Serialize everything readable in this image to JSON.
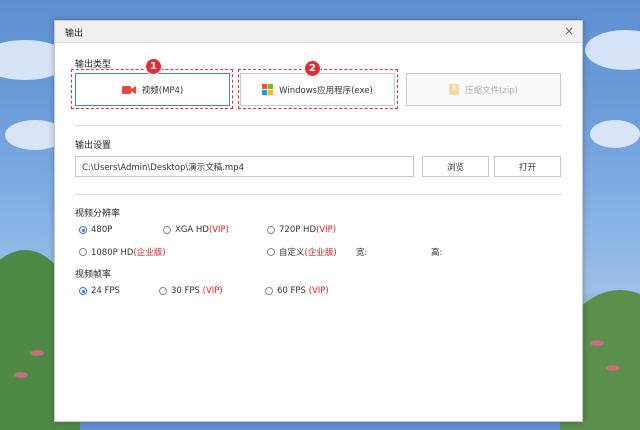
{
  "dialog": {
    "title": "输出",
    "close_glyph": "×"
  },
  "output_type": {
    "heading": "输出类型",
    "options": [
      {
        "label": "视频(MP4)",
        "icon": "video-camera-icon",
        "selected": true,
        "badge": "1"
      },
      {
        "label": "Windows应用程序(exe)",
        "icon": "windows-icon",
        "selected": false,
        "badge": "2"
      },
      {
        "label": "压缩文件(zip)",
        "icon": "zip-archive-icon",
        "selected": false,
        "disabled": true
      }
    ]
  },
  "output_settings": {
    "heading": "输出设置",
    "path_value": "C:\\Users\\Admin\\Desktop\\演示文稿.mp4",
    "browse_label": "浏览",
    "open_label": "打开"
  },
  "resolution": {
    "heading": "视频分辨率",
    "opt_480": "480P",
    "opt_xga": "XGA HD",
    "opt_xga_tag": "(VIP)",
    "opt_720": "720P HD",
    "opt_720_tag": "(VIP)",
    "opt_1080": "1080P HD",
    "opt_1080_tag": "(企业版)",
    "opt_custom": "自定义",
    "opt_custom_tag": "(企业版)",
    "width_label": "宽:",
    "height_label": "高:",
    "selected": "480P"
  },
  "framerate": {
    "heading": "视频帧率",
    "opt_24": "24 FPS",
    "opt_30": "30 FPS",
    "opt_30_tag": "(VIP)",
    "opt_60": "60 FPS",
    "opt_60_tag": "(VIP)",
    "selected": "24 FPS"
  },
  "colors": {
    "accent": "#3a74d8",
    "highlight": "#e02d33",
    "vip_text": "#e02020"
  }
}
